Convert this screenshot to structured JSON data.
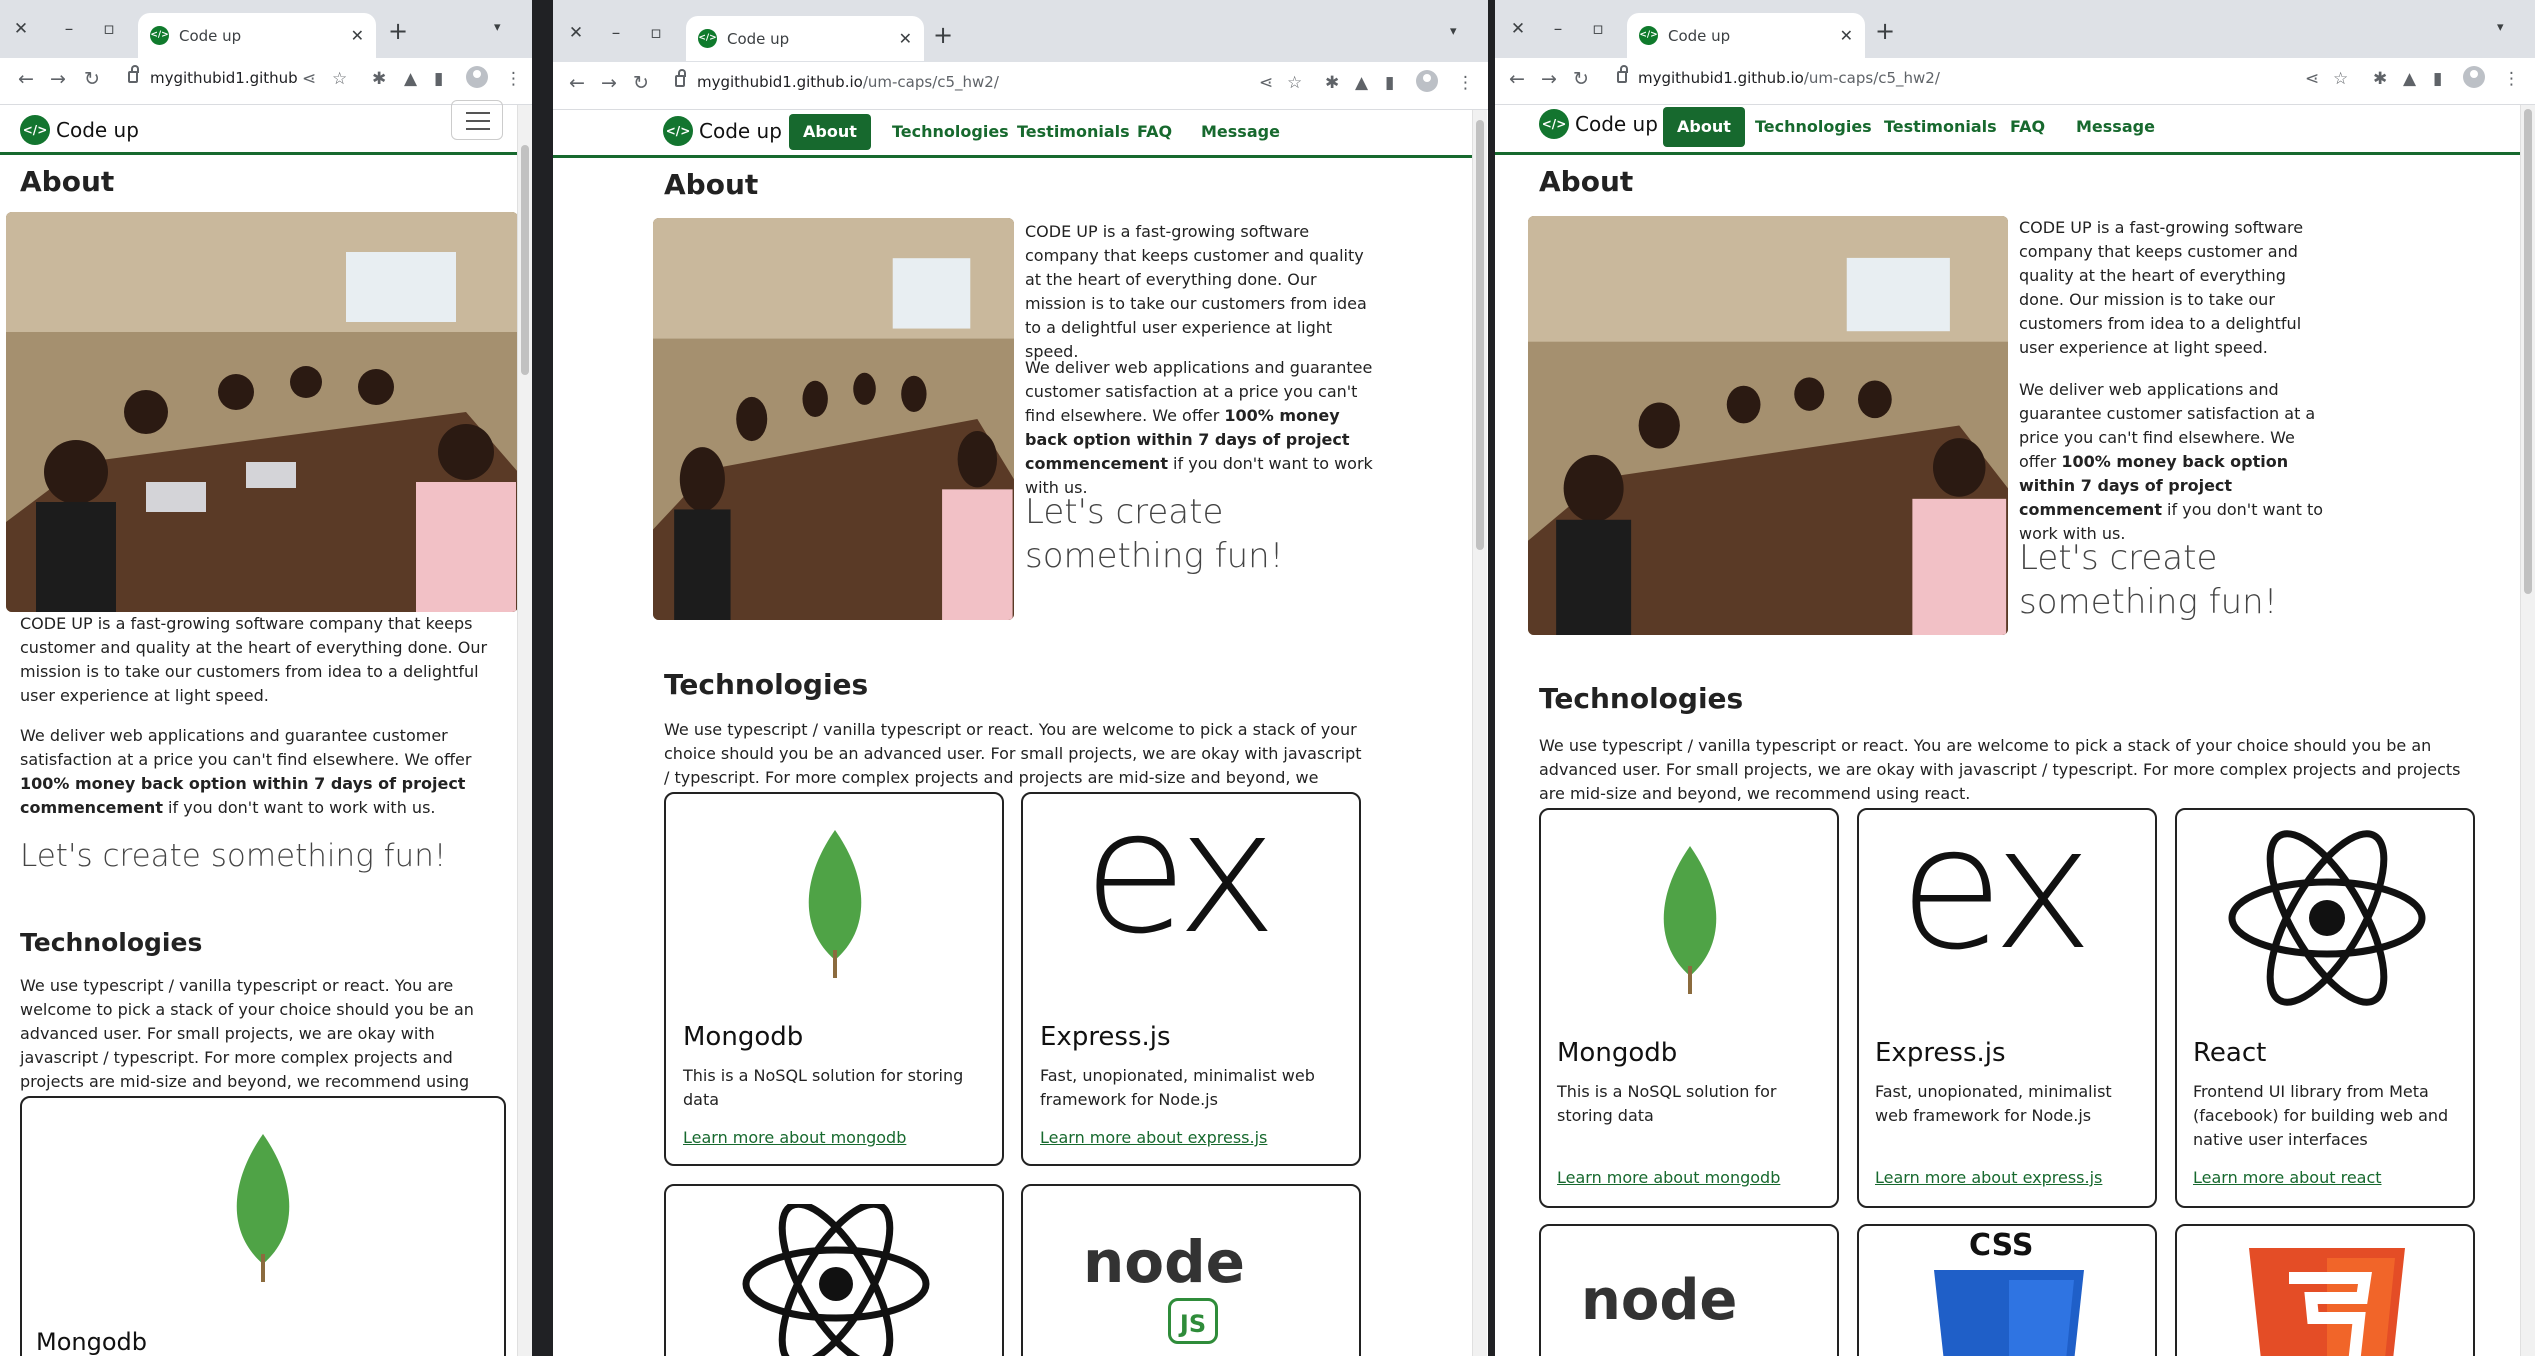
{
  "tab_title": "Code up",
  "url_domain": "mygithubid1.github.io",
  "url_path": "/um-caps/c5_hw2/",
  "url_truncated": "mygithubid1.github.i...",
  "brand": "Code up",
  "nav": [
    "About",
    "Technologies",
    "Testimonials",
    "FAQ",
    "Message"
  ],
  "about": {
    "heading": "About",
    "p1": "CODE UP is a fast-growing software company that keeps customer and quality at the heart of everything done. Our mission is to take our customers from idea to a delightful user experience at light speed.",
    "p2_start": "We deliver web applications and guarantee customer satisfaction at a price you can't find elsewhere. We offer ",
    "p2_bold": "100% money back option within 7 days of project commencement",
    "p2_end": " if you don't want to work with us.",
    "fun": "Let's create something fun!"
  },
  "tech": {
    "heading": "Technologies",
    "intro": "We use typescript / vanilla typescript or react. You are welcome to pick a stack of your choice should you be an advanced user. For small projects, we are okay with javascript / typescript. For more complex projects and projects are mid-size and beyond, we recommend using react.",
    "cards": [
      {
        "title": "Mongodb",
        "desc": "This is a NoSQL solution for storing data",
        "link": "Learn more about mongodb"
      },
      {
        "title": "Express.js",
        "desc": "Fast, unopionated, minimalist web framework for Node.js",
        "link": "Learn more about express.js"
      },
      {
        "title": "React",
        "desc": "Frontend UI library from Meta (facebook) for building web and native user interfaces",
        "link": "Learn more about react"
      }
    ],
    "logo_text_ex": "ex",
    "logo_text_css": "CSS",
    "logo_text_html": "5",
    "logo_text_node": "node",
    "logo_text_js": "JS"
  },
  "colors": {
    "brand_green": "#17692e"
  }
}
